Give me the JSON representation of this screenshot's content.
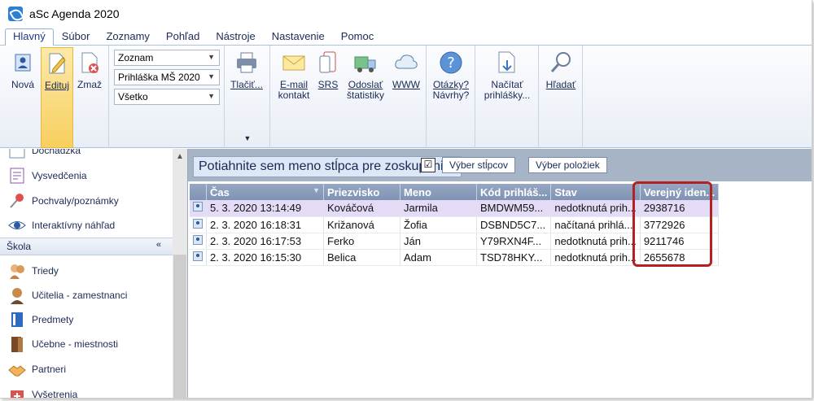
{
  "window": {
    "title": "aSc Agenda 2020"
  },
  "menu": {
    "tabs": [
      "Hlavný",
      "Súbor",
      "Zoznamy",
      "Pohľad",
      "Nástroje",
      "Nastavenie",
      "Pomoc"
    ]
  },
  "ribbon": {
    "new_label": "Nová",
    "edit_label": "Edituj",
    "delete_label": "Zmaž",
    "dropdowns": [
      "Zoznam",
      "Prihláška MŠ 2020",
      "Všetko"
    ],
    "print_label": "Tlačiť...",
    "email_label_1": "E-mail",
    "email_label_2": "kontakt",
    "srs_label": "SRS",
    "stats_label_1": "Odoslať",
    "stats_label_2": "štatistiky",
    "www_label": "WWW",
    "help_label_1": "Otázky?",
    "help_label_2": "Návrhy?",
    "load_label_1": "Načítať",
    "load_label_2": "prihlášky...",
    "search_label": "Hľadať"
  },
  "sidebar": {
    "items_top": [
      "Dochádzka",
      "Vysvedčenia",
      "Pochvaly/poznámky",
      "Interaktívny náhľad"
    ],
    "section": "Škola",
    "items_school": [
      "Triedy",
      "Učitelia - zamestnanci",
      "Predmety",
      "Učebne - miestnosti",
      "Partneri",
      "Vyšetrenia"
    ]
  },
  "main": {
    "group_hint": "Potiahnite sem meno stĺpca pre zoskupenie",
    "checkbox": "☑",
    "select_columns": "Výber stĺpcov",
    "select_items": "Výber položiek",
    "columns": [
      "Čas",
      "Priezvisko",
      "Meno",
      "Kód prihláš...",
      "Stav",
      "Verejný iden..."
    ],
    "rows": [
      [
        "5. 3. 2020 13:14:49",
        "Kováčová",
        "Jarmila",
        "BMDWM59...",
        "nedotknutá prih...",
        "2938716"
      ],
      [
        "2. 3. 2020 16:18:31",
        "Križanová",
        "Žofia",
        "DSBND5C7...",
        "načítaná prihlá...",
        "3772926"
      ],
      [
        "2. 3. 2020 16:17:53",
        "Ferko",
        "Ján",
        "Y79RXN4F...",
        "nedotknutá prih...",
        "9211746"
      ],
      [
        "2. 3. 2020 16:15:30",
        "Belica",
        "Adam",
        "TSD78HKY...",
        "nedotknutá prih...",
        "2655678"
      ]
    ]
  },
  "colors": {
    "accent": "#2d7fd3",
    "header": "#8a9dbb",
    "highlight": "#b22222",
    "selected_row": "#e4dcf7"
  }
}
